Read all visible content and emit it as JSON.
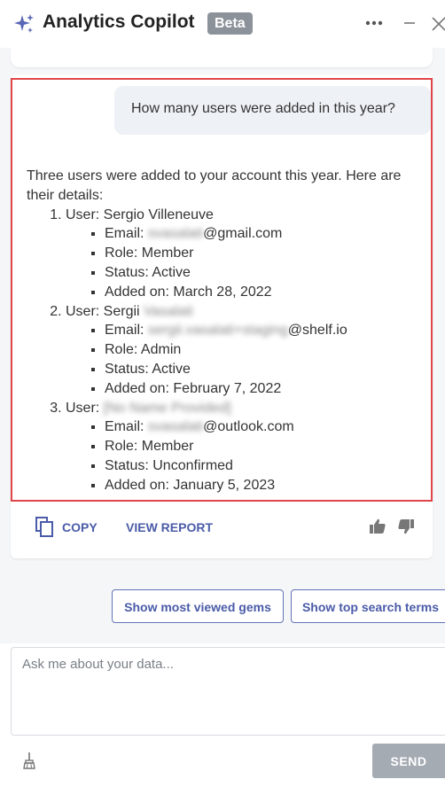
{
  "header": {
    "title": "Analytics Copilot",
    "badge": "Beta"
  },
  "conversation": {
    "user_question": "How many users were added in this year?",
    "answer_intro": "Three users were added to your account this year. Here are their details:",
    "users": [
      {
        "user_label": "User: ",
        "user_name": "Sergio Villeneuve",
        "user_name_blurred": "",
        "email_label": "Email: ",
        "email_blurred": "svasalati",
        "email_domain": "@gmail.com",
        "role": "Role: Member",
        "status": "Status: Active",
        "added_on": "Added on: March 28, 2022"
      },
      {
        "user_label": "User: ",
        "user_name": "Sergii ",
        "user_name_blurred": "Vasalati",
        "email_label": "Email: ",
        "email_blurred": "sergii.vasalati+staging",
        "email_domain": "@shelf.io",
        "role": "Role: Admin",
        "status": "Status: Active",
        "added_on": "Added on: February 7, 2022"
      },
      {
        "user_label": "User: ",
        "user_name": "",
        "user_name_blurred": "[No Name Provided]",
        "email_label": "Email: ",
        "email_blurred": "svasalati",
        "email_domain": "@outlook.com",
        "role": "Role: Member",
        "status": "Status: Unconfirmed",
        "added_on": "Added on: January 5, 2023"
      }
    ]
  },
  "actions": {
    "copy_label": "COPY",
    "view_report_label": "VIEW REPORT"
  },
  "suggestions": [
    "Show most viewed gems",
    "Show top search terms"
  ],
  "input": {
    "placeholder": "Ask me about your data..."
  },
  "send_label": "SEND",
  "colors": {
    "accent": "#4a5ba8",
    "highlight_border": "#e0454a",
    "send_disabled": "#a5abb3"
  }
}
